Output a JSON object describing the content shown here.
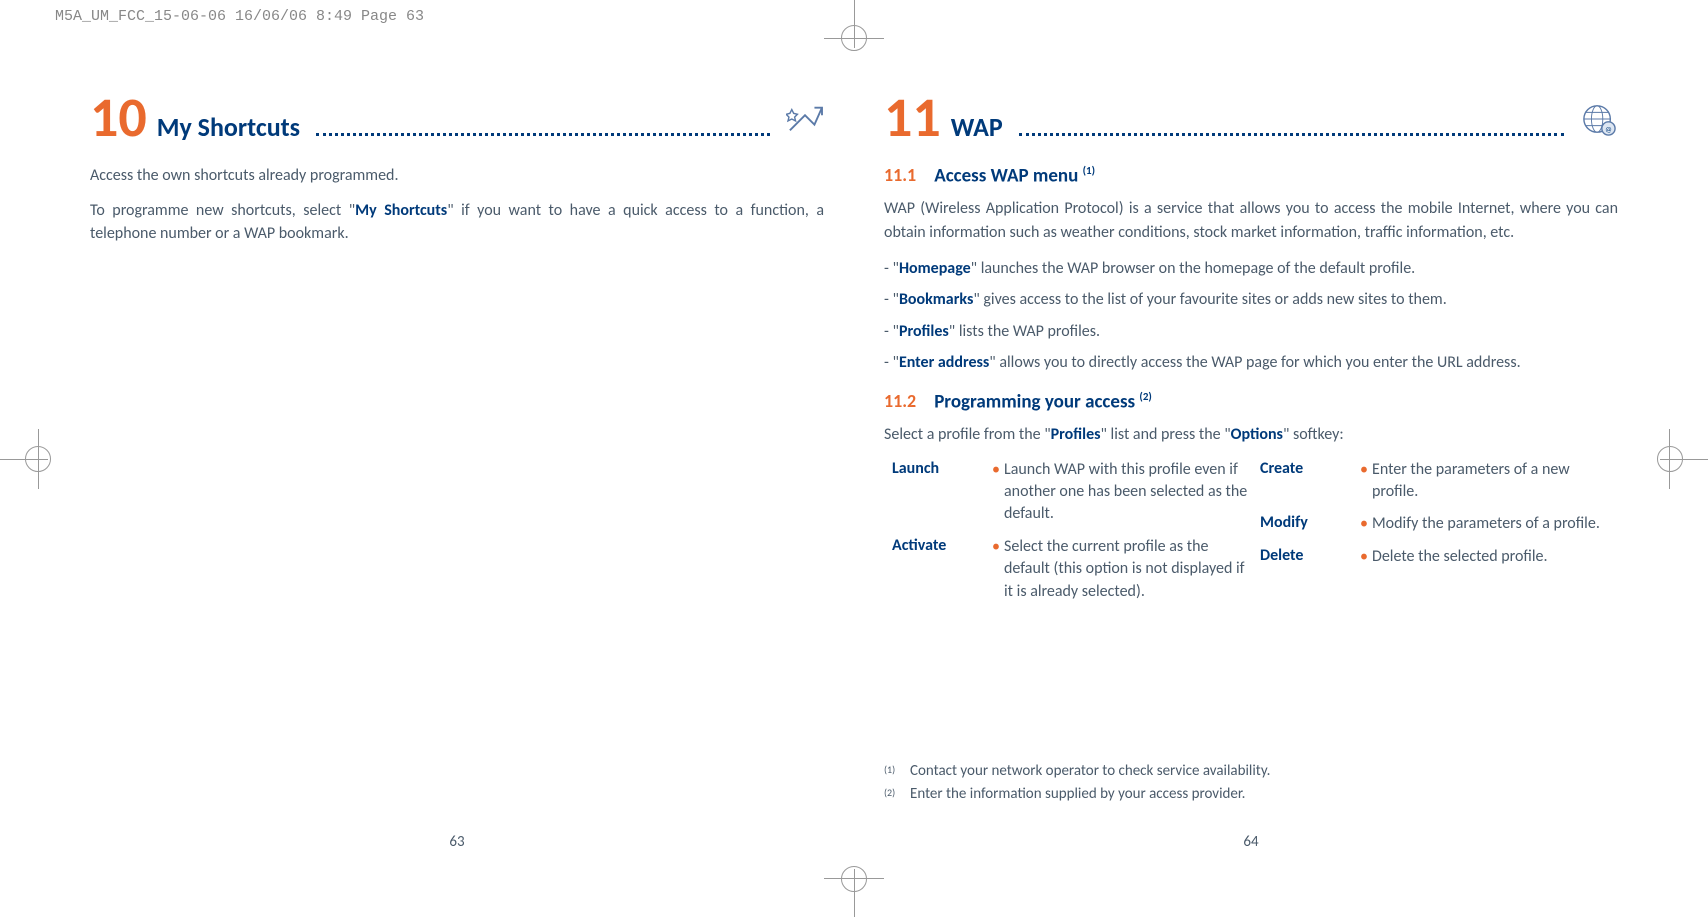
{
  "headerStrip": "M5A_UM_FCC_15-06-06  16/06/06  8:49  Page 63",
  "leftPage": {
    "chapterNum": "10",
    "chapterTitle": "My Shortcuts",
    "para1": "Access the own shortcuts already programmed.",
    "para2_a": "To programme new shortcuts, select \"",
    "para2_b": "My Shortcuts",
    "para2_c": "\" if you want to have a quick access to a function, a telephone number or a WAP bookmark.",
    "pageNum": "63"
  },
  "rightPage": {
    "chapterNum": "11",
    "chapterTitle": "WAP",
    "sec1": {
      "num": "11.1",
      "title": "Access WAP menu",
      "sup": "(1)"
    },
    "intro": "WAP (Wireless Application Protocol) is a service that allows you to access the mobile Internet, where you can obtain information such as weather conditions, stock market information, traffic information, etc.",
    "bullets": [
      {
        "pre": "- \"",
        "term": "Homepage",
        "post": "\" launches the WAP browser on the homepage of the default profile."
      },
      {
        "pre": "- \"",
        "term": "Bookmarks",
        "post": "\" gives access to the list of your favourite sites or adds new sites to them."
      },
      {
        "pre": "- \"",
        "term": "Profiles",
        "post": "\" lists the WAP profiles."
      },
      {
        "pre": "- \"",
        "term": "Enter address",
        "post": "\" allows you to directly access the WAP page for which you enter the URL address."
      }
    ],
    "sec2": {
      "num": "11.2",
      "title": "Programming your access",
      "sup": "(2)"
    },
    "sec2intro_a": "Select a profile from the \"",
    "sec2intro_b": "Profiles",
    "sec2intro_c": "\" list and press the \"",
    "sec2intro_d": "Options",
    "sec2intro_e": "\" softkey:",
    "optionsLeft": [
      {
        "term": "Launch",
        "desc": "Launch WAP with this profile even if another one has been selected as the default."
      },
      {
        "term": "Activate",
        "desc": "Select the current profile as the default (this option is not displayed if it is already selected)."
      }
    ],
    "optionsRight": [
      {
        "term": "Create",
        "desc": "Enter the parameters of a new profile."
      },
      {
        "term": "Modify",
        "desc": "Modify the parameters of a profile."
      },
      {
        "term": "Delete",
        "desc": "Delete the selected profile."
      }
    ],
    "footnotes": [
      {
        "mark": "(1)",
        "text": "Contact your network operator to check service availability."
      },
      {
        "mark": "(2)",
        "text": "Enter the information supplied by your access provider."
      }
    ],
    "pageNum": "64"
  }
}
